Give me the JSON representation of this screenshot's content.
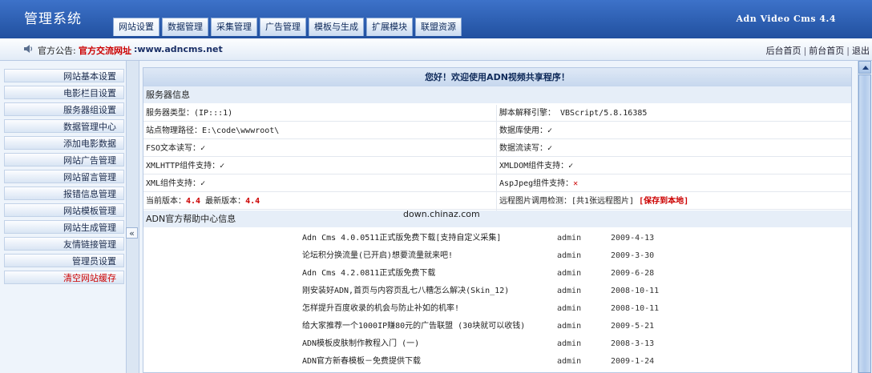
{
  "header": {
    "title": "管理系统",
    "version": "Adn Video Cms 4.4",
    "tabs": [
      "网站设置",
      "数据管理",
      "采集管理",
      "广告管理",
      "模板与生成",
      "扩展模块",
      "联盟资源"
    ]
  },
  "notice": {
    "label": "官方公告:",
    "highlight": "官方交流网址",
    "url": ":www.adncms.net",
    "links": [
      "后台首页",
      "前台首页",
      "退出"
    ],
    "separator": "|"
  },
  "menu": {
    "items": [
      "网站基本设置",
      "电影栏目设置",
      "服务器组设置",
      "数据管理中心",
      "添加电影数据",
      "网站广告管理",
      "网站留言管理",
      "报错信息管理",
      "网站模板管理",
      "网站生成管理",
      "友情链接管理",
      "管理员设置"
    ],
    "clear_cache": "清空网站缓存"
  },
  "collapse_label": "«",
  "main": {
    "welcome": "您好！欢迎使用ADN视频共享程序！",
    "server_section": "服务器信息",
    "rows": [
      {
        "left": "服务器类型：(IP:::1)",
        "right": "脚本解释引擎： VBScript/5.8.16385"
      },
      {
        "left": "站点物理路径：E:\\code\\wwwroot\\",
        "right_label": "数据库使用：",
        "right_mark": "✓"
      },
      {
        "left_label": "FSO文本读写：",
        "left_mark": "✓",
        "right_label": "数据流读写：",
        "right_mark": "✓"
      },
      {
        "left_label": "XMLHTTP组件支持：",
        "left_mark": "✓",
        "right_label": "XMLDOM组件支持：",
        "right_mark": "✓"
      },
      {
        "left_label": "XML组件支持：",
        "left_mark": "✓",
        "right_label": "AspJpeg组件支持：",
        "right_mark": "✕"
      }
    ],
    "version_row": {
      "current_label": "当前版本：",
      "current": "4.4",
      "latest_label": "最新版本：",
      "latest": "4.4",
      "remote_label": "远程图片调用检测：[共1张远程图片]",
      "save_link": "[保存到本地]"
    },
    "help_section": "ADN官方帮助中心信息",
    "watermark": "down.chinaz.com",
    "news": [
      {
        "title": "Adn Cms 4.0.0511正式版免费下载[支持自定义采集]",
        "author": "admin",
        "date": "2009-4-13"
      },
      {
        "title": "论坛积分换流量(已开启)想要流量就来吧!",
        "author": "admin",
        "date": "2009-3-30"
      },
      {
        "title": "Adn Cms 4.2.0811正式版免费下载",
        "author": "admin",
        "date": "2009-6-28"
      },
      {
        "title": "刚安装好ADN,首页与内容页乱七八糟怎么解决(Skin_12)",
        "author": "admin",
        "date": "2008-10-11"
      },
      {
        "title": "怎样提升百度收录的机会与防止补如的机率!",
        "author": "admin",
        "date": "2008-10-11"
      },
      {
        "title": "给大家推荐一个1000IP赚80元的广告联盟 (30块就可以收钱)",
        "author": "admin",
        "date": "2009-5-21"
      },
      {
        "title": "ADN模板皮肤制作教程入门 (一)",
        "author": "admin",
        "date": "2008-3-13"
      },
      {
        "title": "ADN官方新春模板－免费提供下载",
        "author": "admin",
        "date": "2009-1-24"
      }
    ]
  }
}
